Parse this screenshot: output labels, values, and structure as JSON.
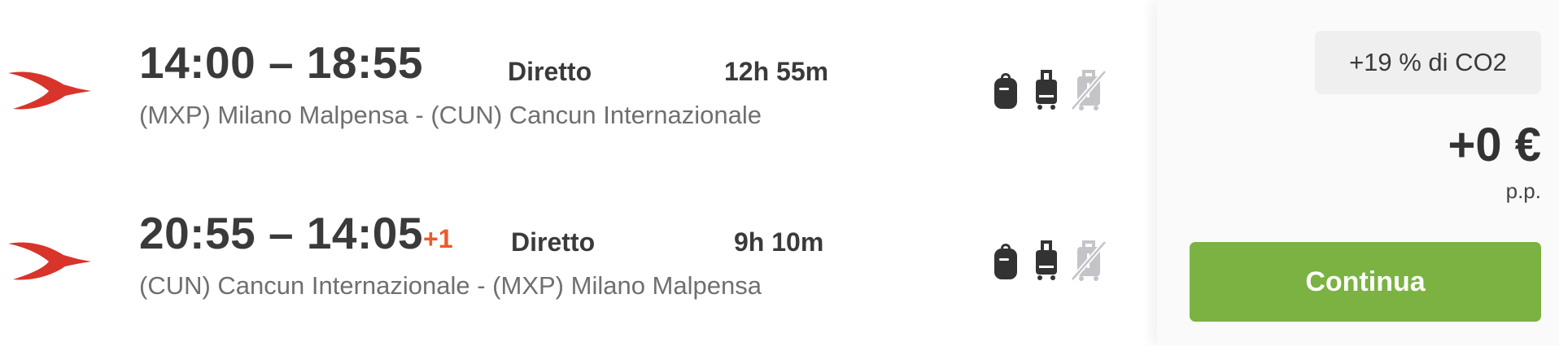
{
  "colors": {
    "airline_red": "#d8342b",
    "day_offset": "#ea5b2a",
    "primary_text": "#3a3a3a",
    "secondary_text": "#6f6f6f",
    "bag_included": "#333333",
    "bag_excluded": "#c4c4c8",
    "continue_green": "#7bb241",
    "co2_badge_bg": "#efefef"
  },
  "legs": [
    {
      "times": "14:00 – 18:55",
      "day_offset": "",
      "stops": "Diretto",
      "duration": "12h 55m",
      "route": "(MXP) Milano Malpensa - (CUN) Cancun Internazionale",
      "airline_icon": "airline-swallow-logo",
      "baggage": [
        {
          "icon": "personal-bag-icon",
          "included": true
        },
        {
          "icon": "cabin-bag-icon",
          "included": true
        },
        {
          "icon": "checked-bag-icon",
          "included": false
        }
      ]
    },
    {
      "times": "20:55 – 14:05",
      "day_offset": "+1",
      "stops": "Diretto",
      "duration": "9h 10m",
      "route": "(CUN) Cancun Internazionale - (MXP) Milano Malpensa",
      "airline_icon": "airline-swallow-logo",
      "baggage": [
        {
          "icon": "personal-bag-icon",
          "included": true
        },
        {
          "icon": "cabin-bag-icon",
          "included": true
        },
        {
          "icon": "checked-bag-icon",
          "included": false
        }
      ]
    }
  ],
  "pricing": {
    "co2_badge": "+19 % di CO2",
    "price": "+0 €",
    "per_person": "p.p.",
    "continue_label": "Continua"
  }
}
